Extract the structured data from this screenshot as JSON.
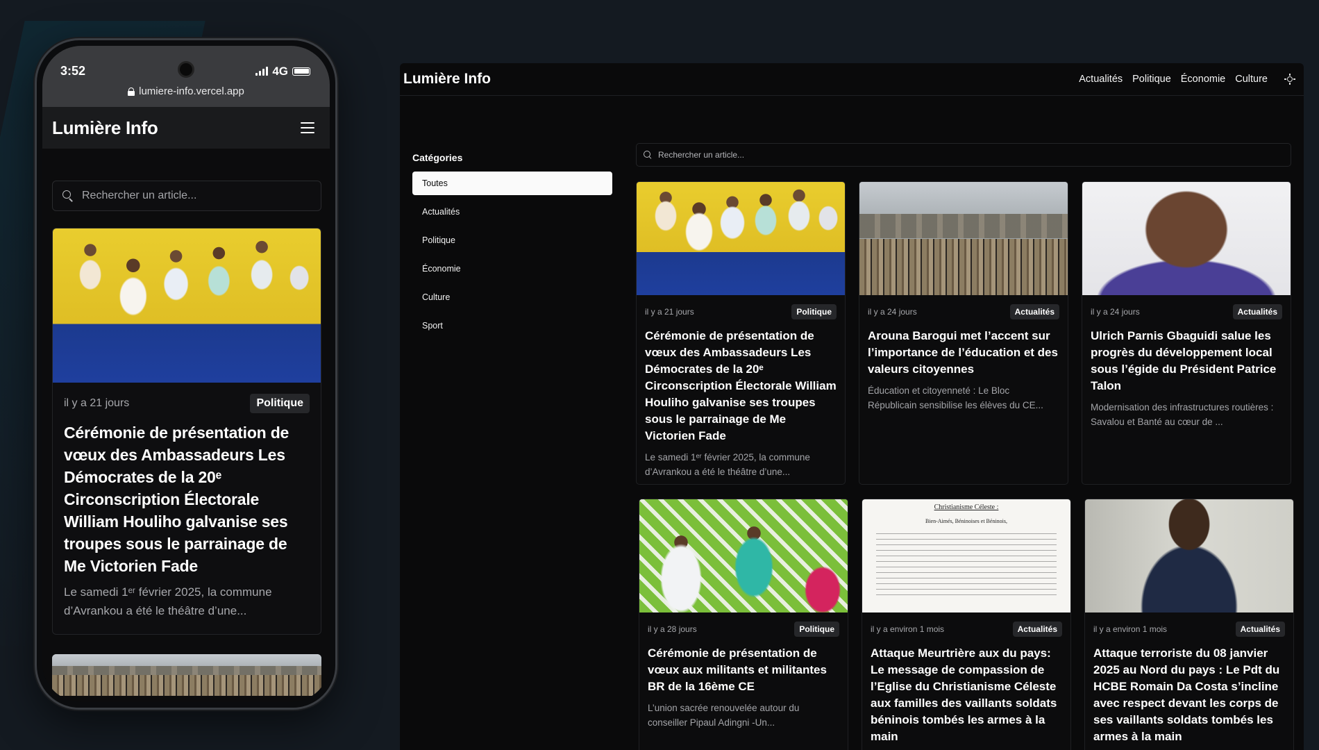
{
  "phone": {
    "status_time": "3:52",
    "network": "4G",
    "url": "lumiere-info.vercel.app",
    "logo": "Lumière Info",
    "search_placeholder": "Rechercher un article...",
    "card": {
      "date": "il y a 21 jours",
      "category": "Politique",
      "title": "Cérémonie de présentation de vœux des Ambassadeurs Les Démocrates de la 20ᵉ Circonscription Électorale William Houliho galvanise ses troupes sous le parrainage de Me Victorien Fade",
      "excerpt": "Le samedi 1ᵉʳ février 2025, la commune d’Avrankou a été le théâtre d’une..."
    }
  },
  "desktop": {
    "logo": "Lumière Info",
    "nav": [
      "Actualités",
      "Politique",
      "Économie",
      "Culture"
    ],
    "sidebar_title": "Catégories",
    "categories": [
      "Toutes",
      "Actualités",
      "Politique",
      "Économie",
      "Culture",
      "Sport"
    ],
    "active_category": "Toutes",
    "search_placeholder": "Rechercher un article...",
    "articles": [
      {
        "date": "il y a 21 jours",
        "category": "Politique",
        "title": "Cérémonie de présentation de vœux des Ambassadeurs Les Démocrates de la 20ᵉ Circonscription Électorale William Houliho galvanise ses troupes sous le parrainage de Me Victorien Fade",
        "excerpt": "Le samedi 1ᵉʳ février 2025, la commune d’Avrankou a été le théâtre d’une..."
      },
      {
        "date": "il y a 24 jours",
        "category": "Actualités",
        "title": "Arouna Barogui met l’accent sur l’importance de l’éducation et des valeurs citoyennes",
        "excerpt": "Éducation et citoyenneté : Le Bloc Républicain sensibilise les élèves du CE..."
      },
      {
        "date": "il y a 24 jours",
        "category": "Actualités",
        "title": "Ulrich Parnis Gbaguidi salue les progrès du développement local sous l’égide du Président Patrice Talon",
        "excerpt": "Modernisation des infrastructures routières : Savalou et Banté au cœur de ..."
      },
      {
        "date": "il y a 28 jours",
        "category": "Politique",
        "title": "Cérémonie de présentation de vœux aux militants et militantes BR de la 16ème CE",
        "excerpt": "L’union sacrée renouvelée autour du conseiller Pipaul Adingni -Un..."
      },
      {
        "date": "il y a environ 1 mois",
        "category": "Actualités",
        "title": "Attaque Meurtrière aux du pays: Le message de compassion de l’Eglise du Christianisme Céleste aux familles des vaillants soldats béninois tombés les armes à la main",
        "excerpt": ""
      },
      {
        "date": "il y a environ 1 mois",
        "category": "Actualités",
        "title": "Attaque terroriste du 08 janvier 2025 au Nord du pays : Le Pdt du HCBE Romain Da Costa s’incline avec respect devant les corps de ses vaillants soldats tombés les armes à la main",
        "excerpt": ""
      }
    ],
    "doc_thumb": {
      "title": "Christianisme Céleste :",
      "subtitle": "Bien-Aimés, Béninoises et Béninois,"
    }
  }
}
